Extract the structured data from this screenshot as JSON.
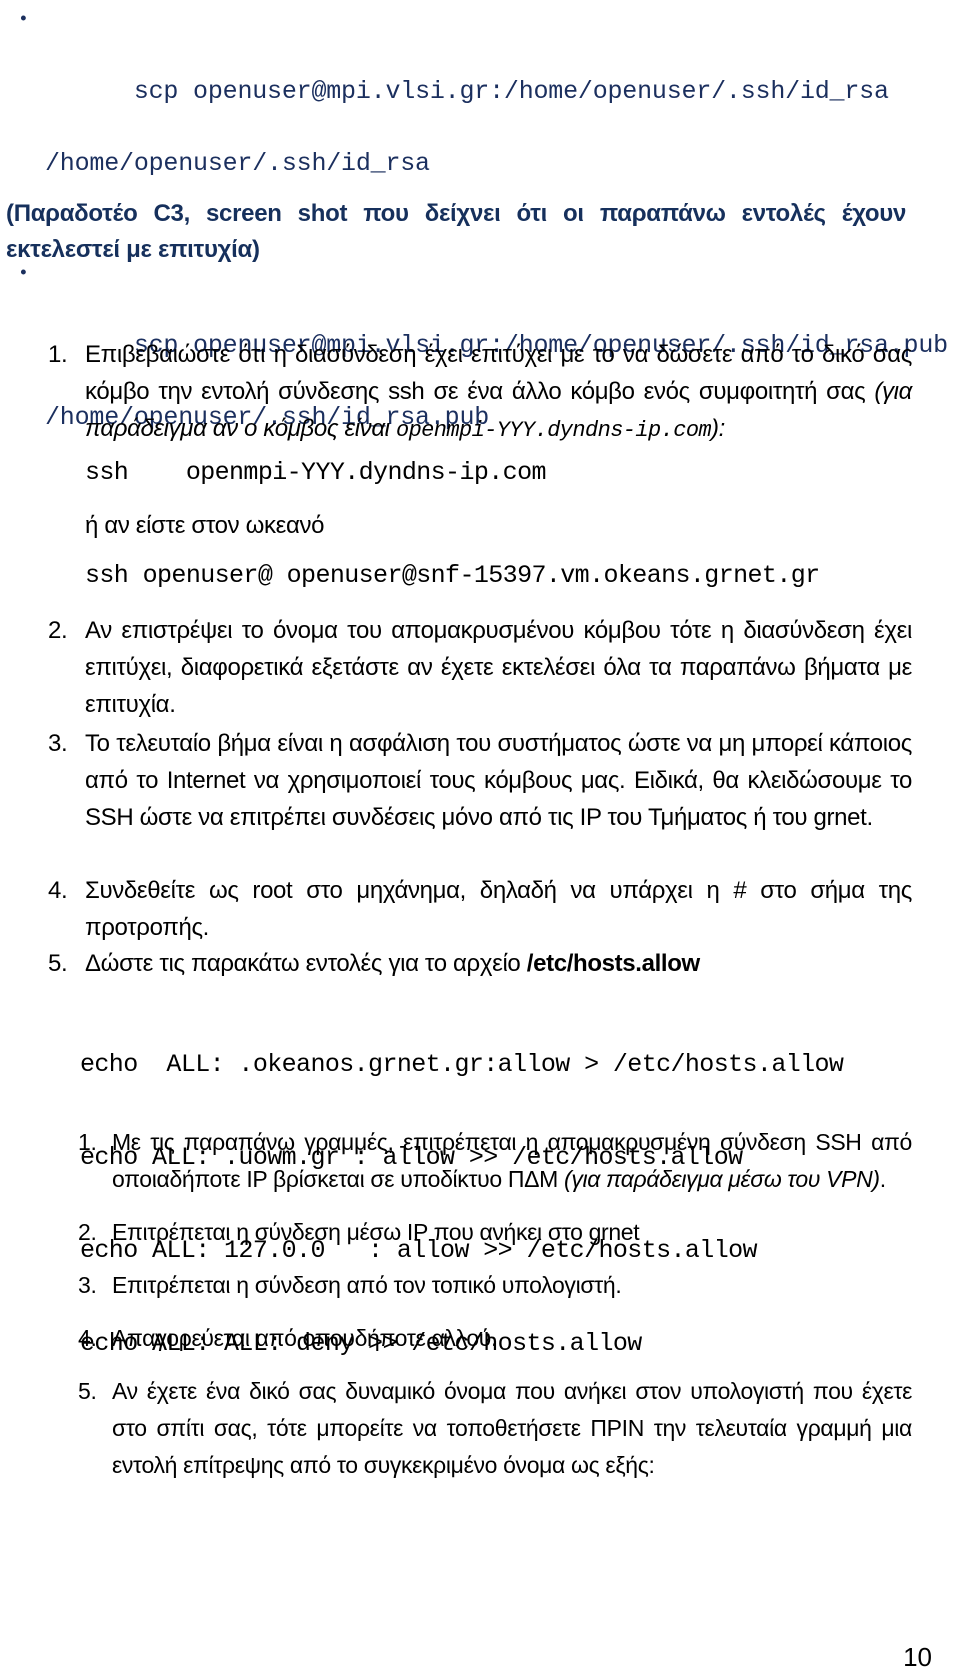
{
  "document": {
    "page_number": "10",
    "accent_navy": "#16305c",
    "body_color": "#000000"
  },
  "top_commands": {
    "bullet_glyph": "•",
    "items": [
      {
        "line1": "scp openuser@mpi.vlsi.gr:/home/openuser/.ssh/id_rsa",
        "line2": "/home/openuser/.ssh/id_rsa"
      },
      {
        "line1": "scp openuser@mpi.vlsi.gr:/home/openuser/.ssh/id_rsa.pub",
        "line2": "/home/openuser/.ssh/id_rsa.pub"
      }
    ]
  },
  "deliverable_note": "(Παραδοτέο C3, screen shot που δείχνει ότι οι παραπάνω εντολές έχουν εκτελεστεί με επιτυχία)",
  "steps": {
    "step1": {
      "number": "1.",
      "text_part1": "Επιβεβαιώστε ότι η διασύνδεση έχει επιτύχει με το να δώσετε από το δικό σας κόμβο την εντολή σύνδεσης ssh σε ένα άλλο κόμβο ενός συμφοιτητή σας ",
      "italic_part": "(για παράδειγμα αν ο κόμβος είναι ",
      "mono_part": "openmpi-YYY.dyndns-ip.com",
      "text_end": "):",
      "command": "ssh    openmpi-YYY.dyndns-ip.com",
      "alt_intro": "ή αν είστε στον ωκεανό",
      "alt_command": "ssh openuser@ openuser@snf-15397.vm.okeans.grnet.gr"
    },
    "step2": {
      "number": "2.",
      "text": "Αν επιστρέψει το όνομα του απομακρυσμένου κόμβου τότε η διασύνδεση έχει επιτύχει, διαφορετικά εξετάστε αν έχετε εκτελέσει όλα τα παραπάνω βήματα με επιτυχία."
    },
    "step3": {
      "number": "3.",
      "text": "Το τελευταίο βήμα είναι η ασφάλιση του συστήματος ώστε να μη μπορεί κάποιος από το Internet να χρησιμοποιεί τους κόμβους μας. Ειδικά, θα κλειδώσουμε το SSH ώστε να επιτρέπει συνδέσεις μόνο από τις IP του Τμήματος ή του grnet."
    },
    "step4": {
      "number": "4.",
      "text": "Συνδεθείτε ως root στο μηχάνημα, δηλαδή να υπάρχει η # στο σήμα της προτροπής."
    },
    "step5": {
      "number": "5.",
      "text_prefix": "Δώστε τις παρακάτω εντολές για το αρχείο ",
      "file_path_bold": "/etc/hosts.allow"
    }
  },
  "echo_commands": [
    "echo  ALL: .okeanos.grnet.gr:allow > /etc/hosts.allow",
    "echo ALL: .uowm.gr : allow >> /etc/hosts.allow",
    "echo ALL: 127.0.0   : allow >> /etc/hosts.allow",
    "echo ALL: ALL: deny >> /etc/hosts.allow"
  ],
  "substeps": [
    {
      "number": "1.",
      "text_part1": "Με τις παραπάνω γραμμές,  επιτρέπεται η απομακρυσμένη σύνδεση SSH από οποιαδήποτε IP βρίσκεται σε υποδίκτυο ΠΔΜ ",
      "italic_part": "(για παράδειγμα μέσω του VPN)",
      "text_end": "."
    },
    {
      "number": "2.",
      "text_part1": "Επιτρέπεται η σύνδεση μέσω IP που ανήκει στο grnet",
      "italic_part": "",
      "text_end": ""
    },
    {
      "number": "3.",
      "text_part1": "Επιτρέπεται η σύνδεση από τον τοπικό υπολογιστή.",
      "italic_part": "",
      "text_end": ""
    },
    {
      "number": "4.",
      "text_part1": "Απαγορεύεται από οπουδήποτε αλλού.",
      "italic_part": "",
      "text_end": ""
    },
    {
      "number": "5.",
      "text_part1": "Αν έχετε ένα δικό σας δυναμικό όνομα που ανήκει στον υπολογιστή που έχετε στο σπίτι σας, τότε μπορείτε να τοποθετήσετε ΠΡΙΝ την τελευταία γραμμή μια εντολή επίτρεψης από το συγκεκριμένο όνομα ως εξής:",
      "italic_part": "",
      "text_end": ""
    }
  ]
}
